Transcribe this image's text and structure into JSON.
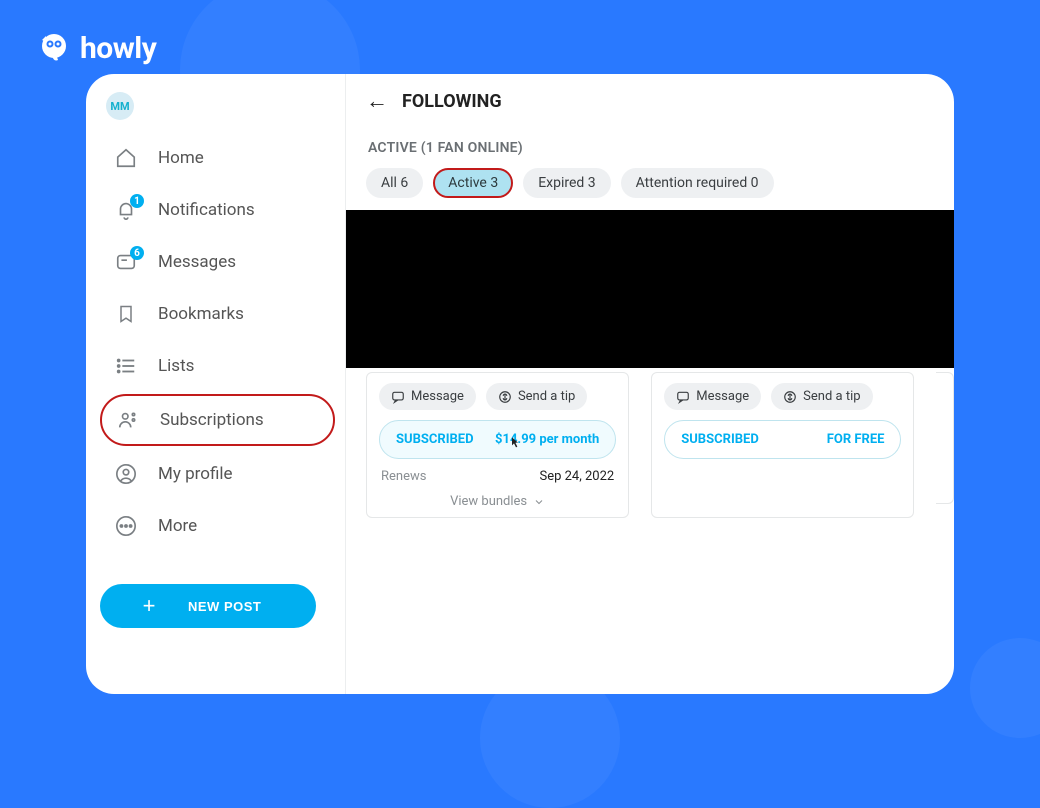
{
  "brand": {
    "name": "howly"
  },
  "sidebar": {
    "avatar_initials": "MM",
    "items": [
      {
        "label": "Home"
      },
      {
        "label": "Notifications",
        "badge": "1"
      },
      {
        "label": "Messages",
        "badge": "6"
      },
      {
        "label": "Bookmarks"
      },
      {
        "label": "Lists"
      },
      {
        "label": "Subscriptions"
      },
      {
        "label": "My profile"
      },
      {
        "label": "More"
      }
    ],
    "new_post_label": "NEW POST"
  },
  "main": {
    "title": "FOLLOWING",
    "subheading": "ACTIVE (1 FAN ONLINE)",
    "filters": {
      "all": "All 6",
      "active": "Active 3",
      "expired": "Expired 3",
      "attention": "Attention required 0"
    },
    "actions": {
      "message": "Message",
      "send_tip": "Send a tip"
    },
    "cards": [
      {
        "status": "SUBSCRIBED",
        "price": "$14.99 per month",
        "renews_label": "Renews",
        "renews_date": "Sep 24, 2022",
        "view_bundles": "View bundles"
      },
      {
        "status": "SUBSCRIBED",
        "price": "FOR FREE"
      }
    ]
  }
}
